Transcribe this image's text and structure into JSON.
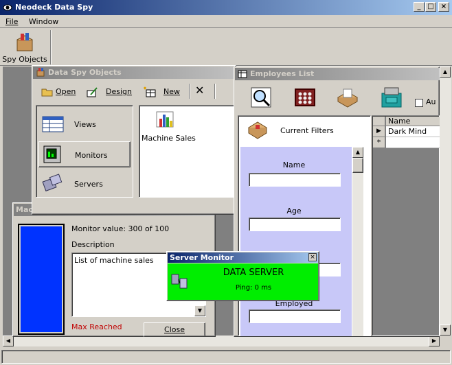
{
  "app": {
    "title": "Neodeck Data Spy"
  },
  "menubar": {
    "file": "File",
    "window": "Window"
  },
  "toolbar": {
    "spy_objects": "Spy Objects"
  },
  "data_spy_objects": {
    "title": "Data Spy Objects",
    "open": "Open",
    "design": "Design",
    "new": "New",
    "views": "Views",
    "monitors": "Monitors",
    "servers": "Servers",
    "item": "Machine Sales"
  },
  "employees_list": {
    "title": "Employees List",
    "auto_label": "Au",
    "current_filters": "Current Filters",
    "fields": [
      "Name",
      "Age",
      "Employed"
    ],
    "grid_header": "Name",
    "grid_row": "Dark Mind",
    "new_row_marker": "*"
  },
  "machine_window": {
    "title": "Mac",
    "monitor_value": "Monitor value: 300 of 100",
    "description_label": "Description",
    "description": "List of machine sales",
    "max_reached": "Max Reached",
    "close": "Close",
    "bar_color": "#0033ff"
  },
  "server_monitor": {
    "title": "Server Monitor",
    "server": "DATA SERVER",
    "ping": "Ping: 0 ms",
    "color": "#00ee00"
  }
}
